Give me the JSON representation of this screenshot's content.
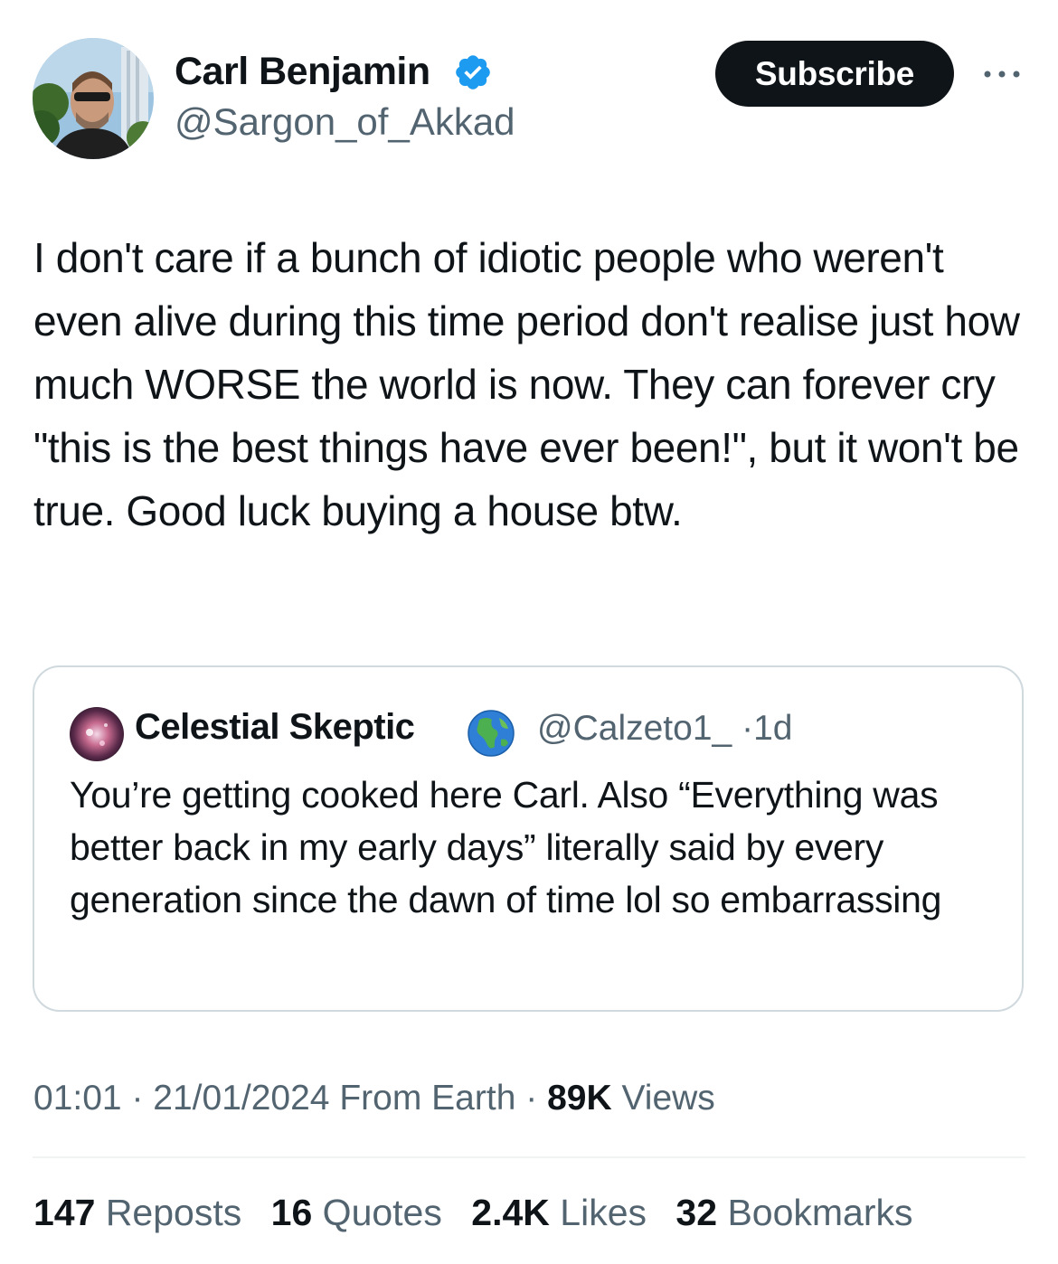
{
  "author": {
    "name": "Carl Benjamin",
    "handle": "@Sargon_of_Akkad",
    "verified_icon": "verified-badge-icon",
    "verified_color": "#1d9bf0"
  },
  "header": {
    "subscribe_label": "Subscribe",
    "more_icon": "more-icon"
  },
  "tweet": {
    "text": "I don't care if a bunch of idiotic people who weren't even alive during this time period don't realise just how much WORSE the world is now. They can forever cry \"this is the best things have ever been!\", but it won't be true. Good luck buying a house btw."
  },
  "quote": {
    "name": "Celestial Skeptic",
    "emoji": "globe-icon",
    "handle": "@Calzeto1_",
    "separator": "·",
    "age": "1d",
    "text": "You’re getting cooked here Carl. Also “Everything was better back in my early days” literally said by every generation since the dawn of time lol so embarrassing"
  },
  "meta": {
    "time": "01:01",
    "separator": "·",
    "date": "21/01/2024",
    "location": "From Earth",
    "views_count": "89K",
    "views_label": "Views"
  },
  "stats": {
    "reposts_count": "147",
    "reposts_label": "Reposts",
    "quotes_count": "16",
    "quotes_label": "Quotes",
    "likes_count": "2.4K",
    "likes_label": "Likes",
    "bookmarks_count": "32",
    "bookmarks_label": "Bookmarks"
  },
  "colors": {
    "text_primary": "#0f1419",
    "text_secondary": "#536471",
    "border": "#cfd9de",
    "button_bg": "#0f1419",
    "verified": "#1d9bf0"
  }
}
